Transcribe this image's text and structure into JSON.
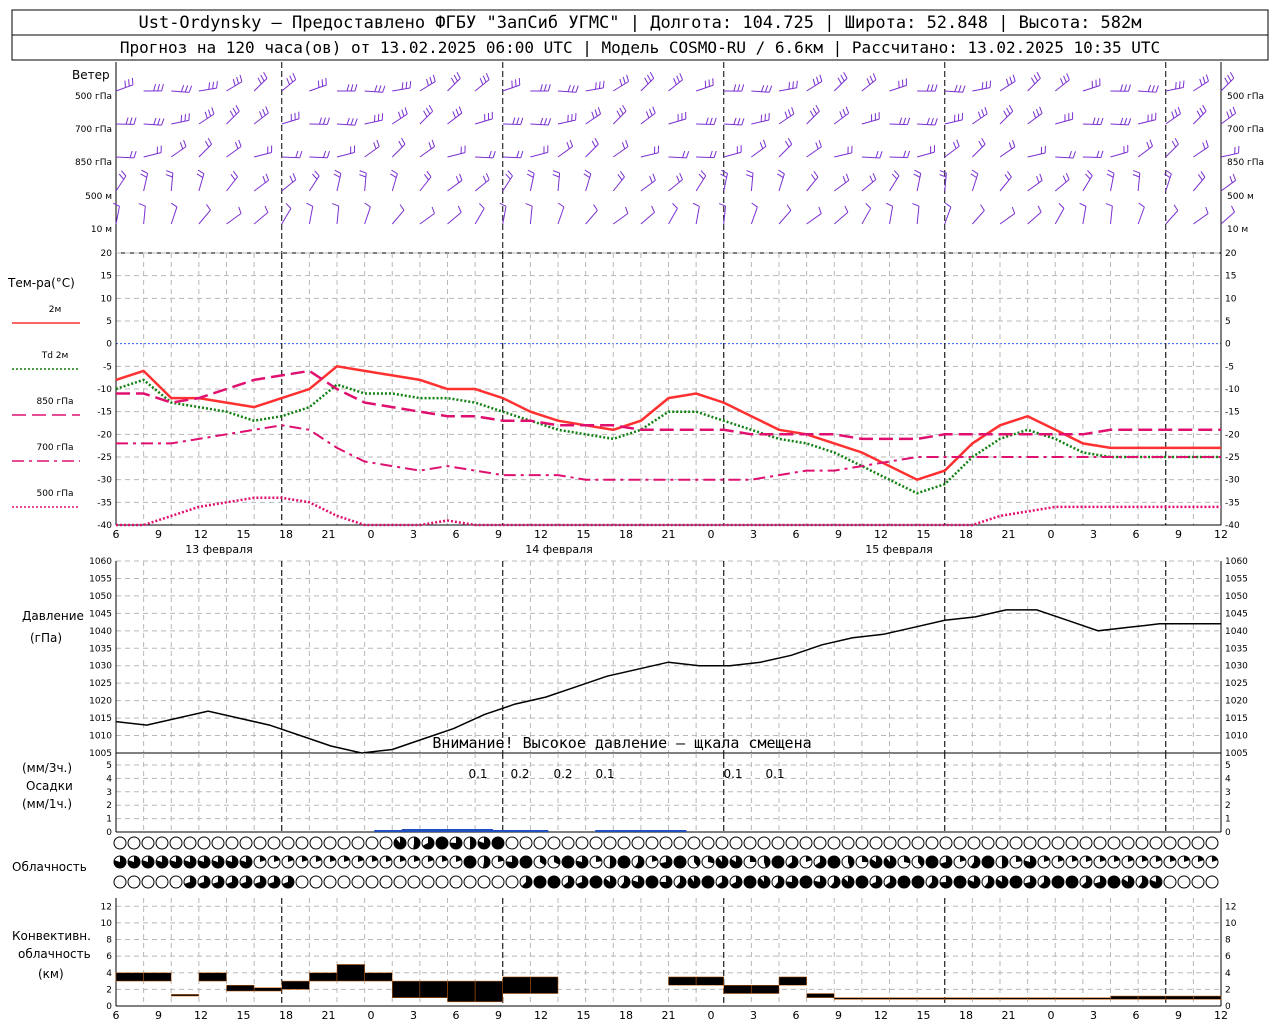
{
  "header": {
    "line1": "Ust-Ordynsky — Предоставлено ФГБУ \"ЗапСиб УГМС\" | Долгота: 104.725 | Широта: 52.848 | Высота: 582м",
    "line2": "Прогноз на 120 часа(ов) от 13.02.2025 06:00 UTC  | Модель COSMO-RU / 6.6км | Рассчитано: 13.02.2025 10:35 UTC"
  },
  "time_axis": {
    "hour_labels": [
      "6",
      "9",
      "12",
      "15",
      "18",
      "21",
      "0",
      "3",
      "6",
      "9",
      "12",
      "15",
      "18",
      "21",
      "0",
      "3",
      "6",
      "9",
      "12",
      "15",
      "18",
      "21",
      "0",
      "3",
      "6",
      "9",
      "12"
    ],
    "day_labels": [
      "13 февраля",
      "14 февраля",
      "15 февраля"
    ]
  },
  "wind": {
    "title": "Ветер",
    "levels": [
      "500 гПа",
      "700 гПа",
      "850 гПа",
      "500 м",
      "10 м"
    ],
    "color": "#7b2fd0"
  },
  "temperature": {
    "title": "Тем-ра(°С)",
    "legend": [
      {
        "label": "2м",
        "color": "#ff3030",
        "style": "solid"
      },
      {
        "label": "Td 2м",
        "color": "#108010",
        "style": "dotted"
      },
      {
        "label": "850 гПа",
        "color": "#e01070",
        "style": "dashed"
      },
      {
        "label": "700 гПа",
        "color": "#e01070",
        "style": "dashdot"
      },
      {
        "label": "500 гПа",
        "color": "#e01070",
        "style": "dotted"
      }
    ],
    "yticks": [
      "20",
      "15",
      "10",
      "5",
      "0",
      "-5",
      "-10",
      "-15",
      "-20",
      "-25",
      "-30",
      "-35",
      "-40"
    ]
  },
  "pressure": {
    "title": "Давление",
    "unit": "(гПа)",
    "yticks": [
      "1060",
      "1055",
      "1050",
      "1045",
      "1040",
      "1035",
      "1030",
      "1025",
      "1020",
      "1015",
      "1010",
      "1005"
    ],
    "warning": "Внимание! Высокое давление — щкала смещена"
  },
  "precip": {
    "label1": "(мм/3ч.)",
    "label2": "Осадки",
    "label3": "(мм/1ч.)",
    "yticks": [
      "5",
      "4",
      "3",
      "2",
      "1",
      "0"
    ],
    "annotations": [
      "0.1",
      "0.2",
      "0.2",
      "0.1",
      "0.1",
      "0.1"
    ],
    "color": "#2050c0"
  },
  "cloud": {
    "title": "Облачность"
  },
  "convective": {
    "title1": "Конвективн.",
    "title2": "облачность",
    "title3": "(км)",
    "yticks": [
      "12",
      "10",
      "8",
      "6",
      "4",
      "2",
      "0"
    ],
    "color": "#f08020"
  },
  "chart_data": [
    {
      "type": "line",
      "title": "Тем-ра(°С)",
      "x_hours": [
        0,
        3,
        6,
        9,
        12,
        15,
        18,
        21,
        24,
        27,
        30,
        33,
        36,
        39,
        42,
        45,
        48,
        51,
        54,
        57,
        60,
        63,
        66,
        69,
        72,
        75,
        78,
        81,
        84,
        87,
        90,
        93,
        96,
        99,
        102,
        105,
        108,
        111,
        114,
        117,
        120
      ],
      "ylim": [
        -40,
        20
      ],
      "series": [
        {
          "name": "2м",
          "values": [
            -8,
            -6,
            -12,
            -12,
            -13,
            -14,
            -12,
            -10,
            -5,
            -6,
            -7,
            -8,
            -10,
            -10,
            -12,
            -15,
            -17,
            -18,
            -19,
            -17,
            -12,
            -11,
            -13,
            -16,
            -19,
            -20,
            -22,
            -24,
            -27,
            -30,
            -28,
            -22,
            -18,
            -16,
            -19,
            -22,
            -23,
            -23,
            -23,
            -23,
            -23
          ]
        },
        {
          "name": "Td 2м",
          "values": [
            -10,
            -8,
            -13,
            -14,
            -15,
            -17,
            -16,
            -14,
            -9,
            -11,
            -11,
            -12,
            -12,
            -13,
            -15,
            -17,
            -19,
            -20,
            -21,
            -19,
            -15,
            -15,
            -17,
            -19,
            -21,
            -22,
            -24,
            -27,
            -30,
            -33,
            -31,
            -25,
            -21,
            -19,
            -21,
            -24,
            -25,
            -25,
            -25,
            -25,
            -25
          ]
        },
        {
          "name": "850 гПа",
          "values": [
            -11,
            -11,
            -13,
            -12,
            -10,
            -8,
            -7,
            -6,
            -10,
            -13,
            -14,
            -15,
            -16,
            -16,
            -17,
            -17,
            -18,
            -18,
            -18,
            -19,
            -19,
            -19,
            -19,
            -20,
            -20,
            -20,
            -20,
            -21,
            -21,
            -21,
            -20,
            -20,
            -20,
            -20,
            -20,
            -20,
            -19,
            -19,
            -19,
            -19,
            -19
          ]
        },
        {
          "name": "700 гПа",
          "values": [
            -22,
            -22,
            -22,
            -21,
            -20,
            -19,
            -18,
            -19,
            -23,
            -26,
            -27,
            -28,
            -27,
            -28,
            -29,
            -29,
            -29,
            -30,
            -30,
            -30,
            -30,
            -30,
            -30,
            -30,
            -29,
            -28,
            -28,
            -27,
            -26,
            -25,
            -25,
            -25,
            -25,
            -25,
            -25,
            -25,
            -25,
            -25,
            -25,
            -25,
            -25
          ]
        },
        {
          "name": "500 гПа",
          "values": [
            -41,
            -40,
            -38,
            -36,
            -35,
            -34,
            -34,
            -35,
            -38,
            -41,
            -41,
            -40,
            -39,
            -40,
            -42,
            -42,
            -42,
            -42,
            -42,
            -42,
            -42,
            -42,
            -42,
            -42,
            -42,
            -42,
            -42,
            -42,
            -42,
            -42,
            -42,
            -40,
            -38,
            -37,
            -36,
            -36,
            -36,
            -36,
            -36,
            -36,
            -36
          ]
        }
      ]
    },
    {
      "type": "line",
      "title": "Давление",
      "x_hours": [
        0,
        3,
        6,
        9,
        12,
        15,
        18,
        21,
        24,
        27,
        30,
        33,
        36,
        39,
        42,
        45,
        48,
        51,
        54,
        57,
        60,
        63,
        66,
        69,
        72,
        75,
        78,
        81,
        84,
        87,
        90,
        93,
        96,
        99,
        102,
        105,
        108
      ],
      "ylim": [
        1005,
        1060
      ],
      "series": [
        {
          "name": "Давление",
          "values": [
            1014,
            1013,
            1015,
            1017,
            1015,
            1013,
            1010,
            1007,
            1005,
            1006,
            1009,
            1012,
            1016,
            1019,
            1021,
            1024,
            1027,
            1029,
            1031,
            1030,
            1030,
            1031,
            1033,
            1036,
            1038,
            1039,
            1041,
            1043,
            1044,
            1046,
            1046,
            1043,
            1040,
            1041,
            1042,
            1042,
            1042
          ]
        }
      ]
    },
    {
      "type": "bar",
      "title": "Осадки",
      "x_hours": [
        30,
        33,
        36,
        39,
        42,
        45,
        48,
        51,
        54,
        57,
        60,
        63,
        66,
        69,
        72,
        75,
        78,
        81,
        84,
        87,
        90,
        93,
        96,
        99,
        102,
        105,
        108,
        111,
        114
      ],
      "ylim": [
        0,
        5
      ],
      "values": [
        0.1,
        0.2,
        0.2,
        0.2,
        0.1,
        0.1,
        0,
        0,
        0.1,
        0.1,
        0.1,
        0,
        0,
        0,
        0,
        0,
        0,
        0,
        0,
        0,
        0,
        0,
        0,
        0,
        0,
        0,
        0,
        0,
        0
      ]
    },
    {
      "type": "bar",
      "title": "Конвективн. облачность",
      "x_hours": [
        0,
        3,
        6,
        9,
        12,
        15,
        18,
        21,
        24,
        27,
        30,
        33,
        36,
        39,
        42,
        45,
        48,
        51,
        54,
        57,
        60,
        63,
        66,
        69,
        72,
        75,
        78,
        81,
        84,
        87,
        90,
        93,
        96,
        99,
        102,
        105,
        108,
        111,
        114,
        117
      ],
      "ylim": [
        0,
        13
      ],
      "bottoms": [
        3,
        3,
        1.2,
        3,
        1.8,
        1.8,
        2,
        3,
        3,
        3,
        1,
        1,
        0.5,
        0.5,
        1.5,
        1.5,
        0,
        0,
        0,
        0,
        2.5,
        2.5,
        1.5,
        1.5,
        2.5,
        1,
        0.8,
        0.8,
        0.8,
        0.8,
        0.8,
        0.8,
        0.8,
        0.8,
        0.8,
        0.8,
        0.8,
        0.8,
        0.8,
        0.8
      ],
      "tops": [
        4,
        4,
        1.4,
        4,
        2.5,
        2.2,
        3,
        4,
        5,
        4,
        3,
        3,
        3,
        3,
        3.5,
        3.5,
        0,
        0,
        0,
        0,
        3.5,
        3.5,
        2.5,
        2.5,
        3.5,
        1.5,
        1,
        1,
        1,
        1,
        1,
        1,
        1,
        1,
        1,
        1,
        1.2,
        1.2,
        1.2,
        1.2
      ]
    }
  ]
}
